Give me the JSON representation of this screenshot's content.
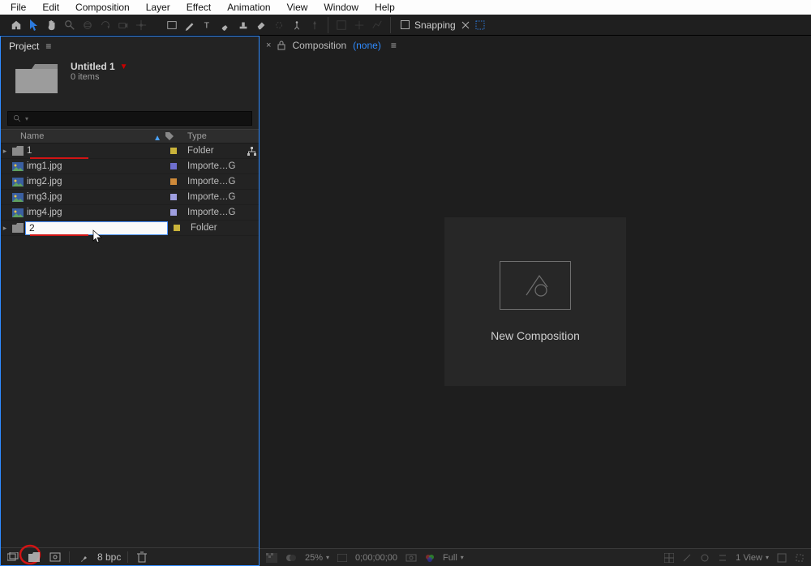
{
  "menubar": [
    "File",
    "Edit",
    "Composition",
    "Layer",
    "Effect",
    "Animation",
    "View",
    "Window",
    "Help"
  ],
  "toolbar": {
    "snapping_label": "Snapping"
  },
  "project": {
    "panel_title": "Project",
    "asset_title": "Untitled 1",
    "asset_sub": "0 items",
    "search_placeholder": "",
    "columns": {
      "name": "Name",
      "type": "Type"
    },
    "rows": [
      {
        "kind": "folder",
        "caret": true,
        "name": "1",
        "tag": "#c9b33a",
        "type": "Folder",
        "link": true,
        "underline": true
      },
      {
        "kind": "image",
        "name": "img1.jpg",
        "tag": "#6f6fcf",
        "type": "Importe…G"
      },
      {
        "kind": "image",
        "name": "img2.jpg",
        "tag": "#cf8a3a",
        "type": "Importe…G"
      },
      {
        "kind": "image",
        "name": "img3.jpg",
        "tag": "#9f9fe0",
        "type": "Importe…G"
      },
      {
        "kind": "image",
        "name": "img4.jpg",
        "tag": "#9f9fe0",
        "type": "Importe…G"
      },
      {
        "kind": "folder",
        "caret": true,
        "editing": true,
        "edit_value": "2",
        "tag": "#c9b33a",
        "type": "Folder",
        "underline": true
      }
    ],
    "footer": {
      "bpc": "8 bpc"
    }
  },
  "composition": {
    "tab_close": "×",
    "label": "Composition",
    "name": "(none)",
    "new_comp": "New Composition",
    "footer": {
      "zoom": "25%",
      "timecode": "0;00;00;00",
      "res": "Full",
      "view": "1 View"
    }
  }
}
